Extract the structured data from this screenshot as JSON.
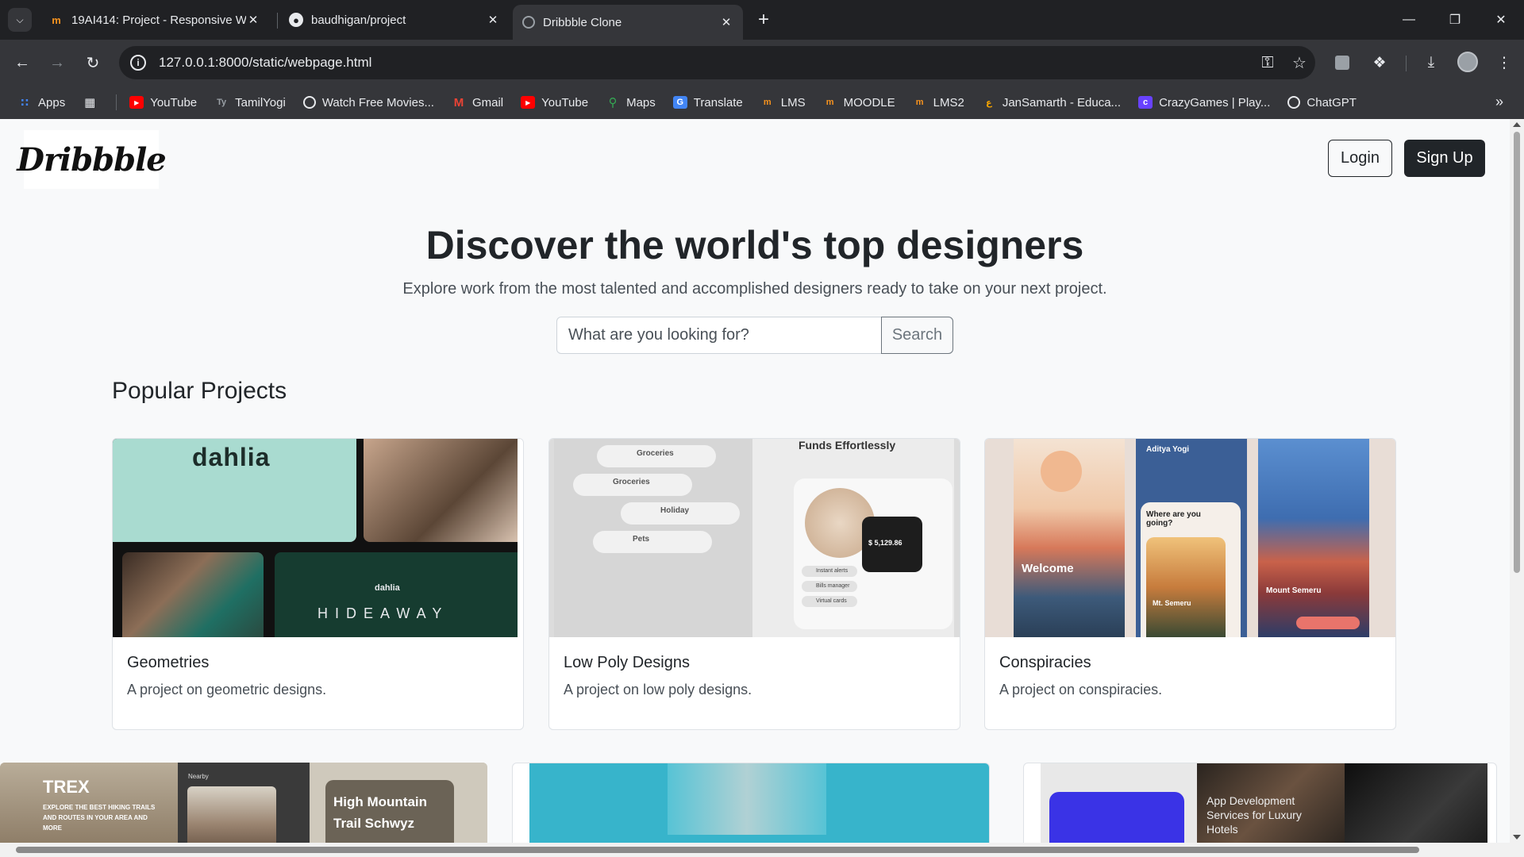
{
  "browser": {
    "tabs": [
      {
        "title": "19AI414: Project - Responsive W",
        "favicon": "moodle-icon"
      },
      {
        "title": "baudhigan/project",
        "favicon": "github-icon"
      },
      {
        "title": "Dribbble Clone",
        "favicon": "globe-icon"
      }
    ],
    "url": "127.0.0.1:8000/static/webpage.html",
    "bookmarks": [
      {
        "label": "Apps",
        "icon": "apps-grid-icon"
      },
      {
        "label": "YouTube",
        "icon": "youtube-icon"
      },
      {
        "label": "TamilYogi",
        "icon": "tamilyogi-icon"
      },
      {
        "label": "Watch Free Movies...",
        "icon": "globe-icon"
      },
      {
        "label": "Gmail",
        "icon": "gmail-icon"
      },
      {
        "label": "YouTube",
        "icon": "youtube-icon"
      },
      {
        "label": "Maps",
        "icon": "maps-icon"
      },
      {
        "label": "Translate",
        "icon": "translate-icon"
      },
      {
        "label": "LMS",
        "icon": "moodle-icon"
      },
      {
        "label": "MOODLE",
        "icon": "moodle-icon"
      },
      {
        "label": "LMS2",
        "icon": "moodle-icon"
      },
      {
        "label": "JanSamarth - Educa...",
        "icon": "jansamarth-icon"
      },
      {
        "label": "CrazyGames | Play...",
        "icon": "crazygames-icon"
      },
      {
        "label": "ChatGPT",
        "icon": "chatgpt-icon"
      }
    ]
  },
  "page": {
    "logo": "Dribbble",
    "login_label": "Login",
    "signup_label": "Sign Up",
    "hero_title": "Discover the world's top designers",
    "hero_subtitle": "Explore work from the most talented and accomplished designers ready to take on your next project.",
    "search_placeholder": "What are you looking for?",
    "search_label": "Search",
    "section_title": "Popular Projects",
    "projects": [
      {
        "title": "Geometries",
        "description": "A project on geometric designs."
      },
      {
        "title": "Low Poly Designs",
        "description": "A project on low poly designs."
      },
      {
        "title": "Conspiracies",
        "description": "A project on conspiracies."
      }
    ],
    "thumb_text": {
      "dahlia_logo": "dahlia",
      "dahlia_small": "HIDEAWAY",
      "dahlia_hideaway": "HIDEAWAY",
      "finance_items": [
        "Groceries",
        "Groceries",
        "Holiday",
        "Pets"
      ],
      "finance_heading": "Funds Effortlessly",
      "finance_amount": "$ 5,129.86",
      "finance_options": [
        "Instant alerts",
        "Bills manager",
        "Virtual cards"
      ],
      "travel_welcome": "Welcome",
      "travel_user": "Aditya Yogi",
      "travel_question": "Where are you going?",
      "travel_place": "Mt. Semeru",
      "travel_mount": "Mount Semeru",
      "trex_title": "TREX",
      "trex_sub": "EXPLORE THE BEST HIKING TRAILS AND ROUTES IN YOUR AREA AND MORE",
      "trex_nearby": "Nearby",
      "trex_trail": "High Mountain Trail Schwyz",
      "appdev_text": "App Development Services for Luxury Hotels"
    }
  },
  "colors": {
    "chrome_dark": "#202124",
    "chrome_toolbar": "#35363a",
    "page_bg": "#f8f9fa",
    "primary_dark": "#212529"
  }
}
